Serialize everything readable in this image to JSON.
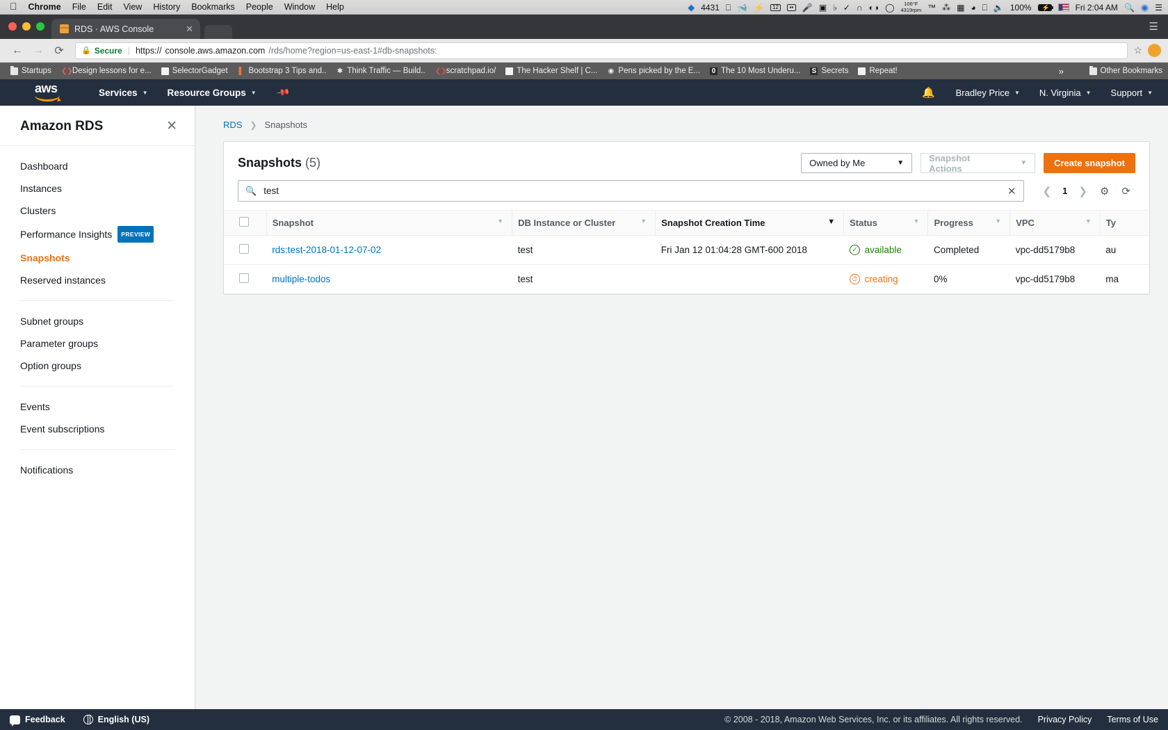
{
  "os_menubar": {
    "apple_icon": "apple-logo",
    "app_name": "Chrome",
    "menus": [
      "File",
      "Edit",
      "View",
      "History",
      "Bookmarks",
      "People",
      "Window",
      "Help"
    ],
    "status": {
      "dropbox_count": "4431",
      "date_badge": "12",
      "temperature": "106°F",
      "fan_speed": "4319rpm",
      "battery_percent": "100%",
      "clock": "Fri 2:04 AM"
    }
  },
  "browser": {
    "tab": {
      "title": "RDS · AWS Console",
      "close_label": "✕"
    },
    "omnibox": {
      "secure_label": "Secure",
      "url_scheme": "https://",
      "url_host": "console.aws.amazon.com",
      "url_path": "/rds/home?region=us-east-1#db-snapshots:"
    },
    "bookmarks": [
      {
        "label": "Startups",
        "icon": "folder"
      },
      {
        "label": "Design lessons for e...",
        "icon": "code"
      },
      {
        "label": "SelectorGadget",
        "icon": "page"
      },
      {
        "label": "Bootstrap 3 Tips and..",
        "icon": "brush"
      },
      {
        "label": "Think Traffic — Build..",
        "icon": "asterisk"
      },
      {
        "label": "scratchpad.io/",
        "icon": "code-red"
      },
      {
        "label": "The Hacker Shelf | C...",
        "icon": "page"
      },
      {
        "label": "Pens picked by the E...",
        "icon": "codepen"
      },
      {
        "label": "The 10 Most Underu...",
        "icon": "square-dark"
      },
      {
        "label": "Secrets",
        "icon": "s-badge"
      },
      {
        "label": "Repeat!",
        "icon": "page"
      }
    ],
    "overflow_label": "»",
    "other_bookmarks": "Other Bookmarks"
  },
  "aws_nav": {
    "logo": "aws",
    "services": "Services",
    "resource_groups": "Resource Groups",
    "pin_icon": "pin-icon",
    "bell_icon": "bell-icon",
    "account": "Bradley Price",
    "region": "N. Virginia",
    "support": "Support"
  },
  "sidebar": {
    "title": "Amazon RDS",
    "close_icon": "close-icon",
    "groups": [
      {
        "items": [
          {
            "label": "Dashboard",
            "active": false
          },
          {
            "label": "Instances",
            "active": false
          },
          {
            "label": "Clusters",
            "active": false
          },
          {
            "label": "Performance Insights",
            "active": false,
            "badge": "PREVIEW"
          },
          {
            "label": "Snapshots",
            "active": true
          },
          {
            "label": "Reserved instances",
            "active": false
          }
        ]
      },
      {
        "items": [
          {
            "label": "Subnet groups",
            "active": false
          },
          {
            "label": "Parameter groups",
            "active": false
          },
          {
            "label": "Option groups",
            "active": false
          }
        ]
      },
      {
        "items": [
          {
            "label": "Events",
            "active": false
          },
          {
            "label": "Event subscriptions",
            "active": false
          }
        ]
      },
      {
        "items": [
          {
            "label": "Notifications",
            "active": false
          }
        ]
      }
    ]
  },
  "breadcrumb": {
    "root": "RDS",
    "separator": "❯",
    "current": "Snapshots"
  },
  "panel": {
    "title": "Snapshots",
    "count": "(5)",
    "owner_filter": "Owned by Me",
    "snapshot_actions": "Snapshot Actions",
    "create_button": "Create snapshot",
    "search_value": "test",
    "search_icon": "search-icon",
    "clear_icon": "clear-icon",
    "page_number": "1",
    "prev_icon": "chevron-left-icon",
    "next_icon": "chevron-right-icon",
    "settings_icon": "gear-icon",
    "refresh_icon": "refresh-icon"
  },
  "table": {
    "columns": [
      {
        "label": "Snapshot",
        "sorted": false
      },
      {
        "label": "DB Instance or Cluster",
        "sorted": false
      },
      {
        "label": "Snapshot Creation Time",
        "sorted": true
      },
      {
        "label": "Status",
        "sorted": false
      },
      {
        "label": "Progress",
        "sorted": false
      },
      {
        "label": "VPC",
        "sorted": false
      },
      {
        "label": "Ty",
        "sorted": false
      }
    ],
    "rows": [
      {
        "snapshot": "rds:test-2018-01-12-07-02",
        "db_instance": "test",
        "creation_time": "Fri Jan 12 01:04:28 GMT-600 2018",
        "status": "available",
        "status_kind": "ok",
        "progress": "Completed",
        "vpc": "vpc-dd5179b8",
        "type": "au"
      },
      {
        "snapshot": "multiple-todos",
        "db_instance": "test",
        "creation_time": "",
        "status": "creating",
        "status_kind": "running",
        "progress": "0%",
        "vpc": "vpc-dd5179b8",
        "type": "ma"
      }
    ]
  },
  "footer": {
    "feedback": "Feedback",
    "language": "English (US)",
    "copyright": "© 2008 - 2018, Amazon Web Services, Inc. or its affiliates. All rights reserved.",
    "privacy": "Privacy Policy",
    "terms": "Terms of Use"
  },
  "colors": {
    "aws_orange": "#ec7211",
    "aws_navy": "#232f3e",
    "link_blue": "#0073bb",
    "status_green": "#1d8102"
  }
}
